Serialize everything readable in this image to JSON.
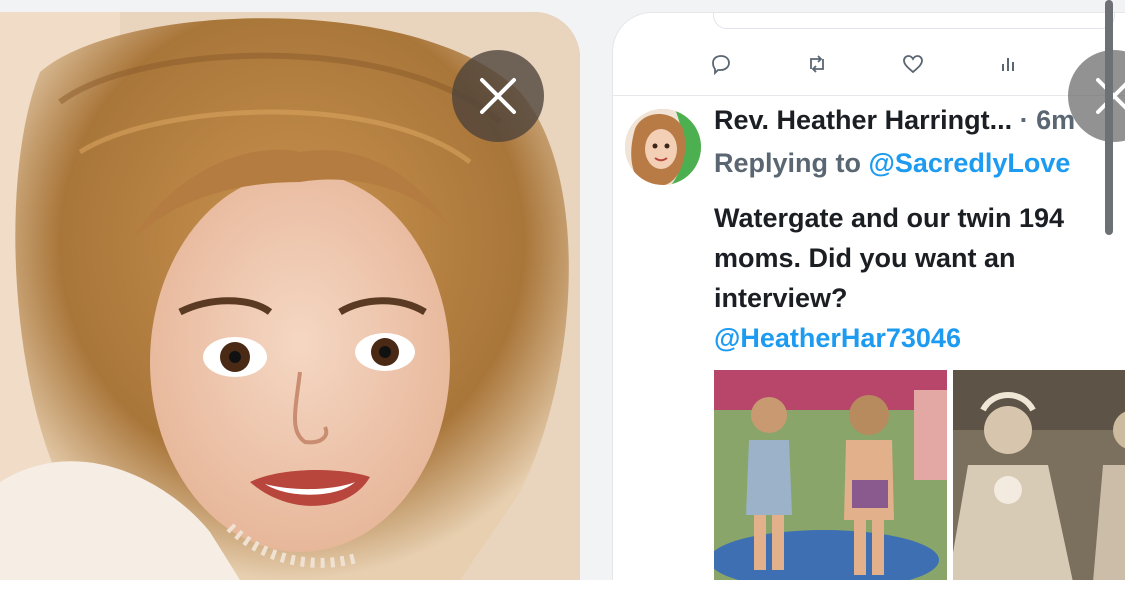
{
  "photo": {
    "alt_icon": "person-photo"
  },
  "controls": {
    "close_icon": "close-icon"
  },
  "tweet": {
    "author_name": "Rev. Heather Harringt...",
    "time_separator": " · ",
    "time": "6m",
    "reply_prefix": "Replying to ",
    "reply_to": "@SacredlyLove",
    "text_lines": [
      "Watergate and our twin 194",
      "moms.  Did you want an",
      "interview?"
    ],
    "mention": "@HeatherHar73046",
    "actions": [
      "reply-icon",
      "retweet-icon",
      "like-icon",
      "views-icon"
    ]
  },
  "colors": {
    "link": "#1d9bf0",
    "text": "#1b1f23",
    "muted": "#5b6673",
    "close_bg": "#4b413a"
  }
}
